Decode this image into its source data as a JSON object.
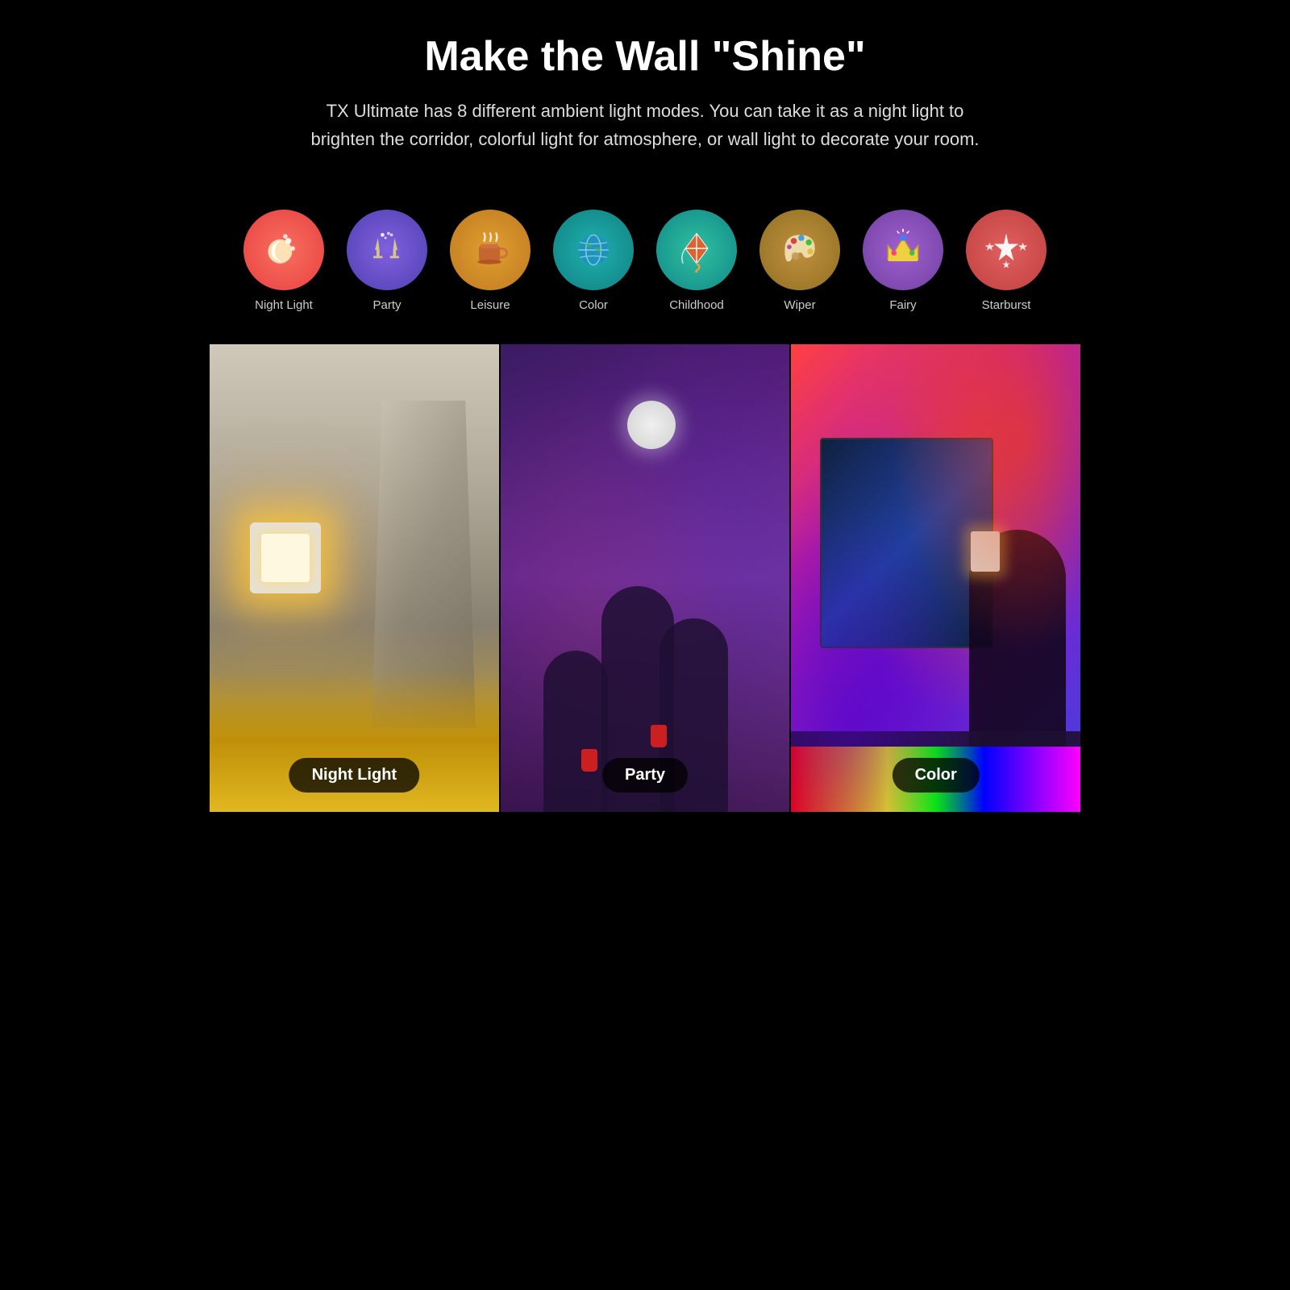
{
  "header": {
    "title": "Make the Wall \"Shine\"",
    "subtitle": "TX Ultimate has 8 different ambient light modes. You can take it as a night light to brighten the corridor, colorful light for atmosphere, or wall light to decorate your room."
  },
  "modes": [
    {
      "id": "night-light",
      "label": "Night Light",
      "emoji": "🌙",
      "bg_class": "bg-red-orange",
      "icon_type": "moon"
    },
    {
      "id": "party",
      "label": "Party",
      "emoji": "🥂",
      "bg_class": "bg-purple",
      "icon_type": "party"
    },
    {
      "id": "leisure",
      "label": "Leisure",
      "emoji": "☕",
      "bg_class": "bg-gold",
      "icon_type": "leisure"
    },
    {
      "id": "color",
      "label": "Color",
      "emoji": "🌍",
      "bg_class": "bg-teal",
      "icon_type": "color"
    },
    {
      "id": "childhood",
      "label": "Childhood",
      "emoji": "🪁",
      "bg_class": "bg-teal2",
      "icon_type": "childhood"
    },
    {
      "id": "wiper",
      "label": "Wiper",
      "emoji": "🎨",
      "bg_class": "bg-dark-gold",
      "icon_type": "wiper"
    },
    {
      "id": "fairy",
      "label": "Fairy",
      "emoji": "👑",
      "bg_class": "bg-purple2",
      "icon_type": "fairy"
    },
    {
      "id": "starburst",
      "label": "Starburst",
      "emoji": "✨",
      "bg_class": "bg-salmon",
      "icon_type": "starburst"
    }
  ],
  "photos": [
    {
      "id": "night-light-panel",
      "label": "Night Light"
    },
    {
      "id": "party-panel",
      "label": "Party"
    },
    {
      "id": "color-panel",
      "label": "Color"
    }
  ],
  "colors": {
    "background": "#000000",
    "title_color": "#ffffff",
    "subtitle_color": "#dddddd",
    "label_bg": "rgba(0,0,0,0.75)"
  }
}
